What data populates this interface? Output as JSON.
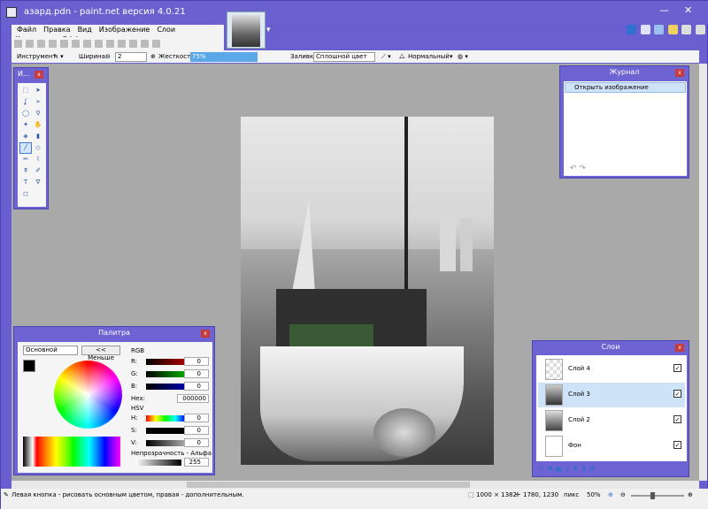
{
  "window": {
    "title": "азард.pdn - paint.net версия 4.0.21"
  },
  "menu": [
    "Файл",
    "Правка",
    "Вид",
    "Изображение",
    "Слои",
    "Коррекция",
    "Эффекты"
  ],
  "toolbar": {
    "tool_label": "Инструмент:",
    "width_label": "Ширина:",
    "width_value": "2",
    "hardness_label": "Жесткость:",
    "hardness_value": "75%",
    "fill_label": "Заливка:",
    "fill_value": "Сплошной цвет",
    "blend_value": "Нормальный"
  },
  "tools_panel": {
    "title": "И..."
  },
  "journal": {
    "title": "Журнал",
    "items": [
      "Открыть изображение"
    ]
  },
  "palette": {
    "title": "Палитра",
    "mode": "Основной",
    "less_button": "<< Меньше",
    "rgb_label": "RGB",
    "r_label": "R:",
    "g_label": "G:",
    "b_label": "B:",
    "r": "0",
    "g": "0",
    "b": "0",
    "hex_label": "Hex:",
    "hex": "000000",
    "hsv_label": "HSV",
    "h_label": "H:",
    "s_label": "S:",
    "v_label": "V:",
    "h": "0",
    "s": "0",
    "v": "0",
    "opacity_label": "Непрозрачность - Альфа",
    "alpha": "255"
  },
  "layers": {
    "title": "Слои",
    "items": [
      {
        "name": "Слой 4",
        "visible": true
      },
      {
        "name": "Слой 3",
        "visible": true
      },
      {
        "name": "Слой 2",
        "visible": true
      },
      {
        "name": "Фон",
        "visible": true
      }
    ]
  },
  "status": {
    "hint": "Левая кнопка - рисовать основным цветом, правая - дополнительным.",
    "image_size": "1000 × 1382",
    "cursor_pos": "1780, 1230",
    "units": "пикс",
    "zoom": "50%"
  },
  "colors": {
    "chrome": "#6a5fd0",
    "accent": "#5ba8e8"
  }
}
